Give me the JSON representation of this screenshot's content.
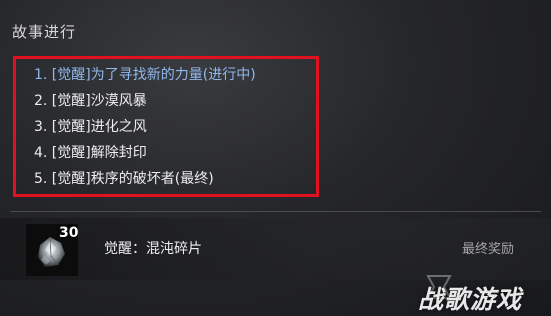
{
  "story": {
    "title": "故事进行",
    "quests": [
      {
        "label": "1. [觉醒]为了寻找新的力量(进行中)",
        "active": true
      },
      {
        "label": "2. [觉醒]沙漠风暴",
        "active": false
      },
      {
        "label": "3. [觉醒]进化之风",
        "active": false
      },
      {
        "label": "4. [觉醒]解除封印",
        "active": false
      },
      {
        "label": "5. [觉醒]秩序的破坏者(最终)",
        "active": false
      }
    ]
  },
  "reward": {
    "count": "30",
    "name": "觉醒：混沌碎片",
    "tag": "最终奖励",
    "icon": "chaos-shard-icon"
  },
  "watermark": {
    "text": "战歌游戏"
  },
  "colors": {
    "active_quest": "#8fb8ec",
    "highlight_border": "#e1111f",
    "text": "#ededed"
  }
}
